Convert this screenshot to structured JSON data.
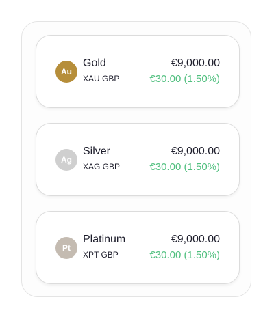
{
  "assets": [
    {
      "badge": "Au",
      "badge_color": "#b68e3a",
      "name": "Gold",
      "pair": "XAU GBP",
      "price": "€9,000.00",
      "change": "€30.00 (1.50%)",
      "change_color": "#4fbf7e"
    },
    {
      "badge": "Ag",
      "badge_color": "#cfcfcf",
      "name": "Silver",
      "pair": "XAG GBP",
      "price": "€9,000.00",
      "change": "€30.00 (1.50%)",
      "change_color": "#4fbf7e"
    },
    {
      "badge": "Pt",
      "badge_color": "#c4bbb1",
      "name": "Platinum",
      "pair": "XPT GBP",
      "price": "€9,000.00",
      "change": "€30.00 (1.50%)",
      "change_color": "#4fbf7e"
    }
  ]
}
